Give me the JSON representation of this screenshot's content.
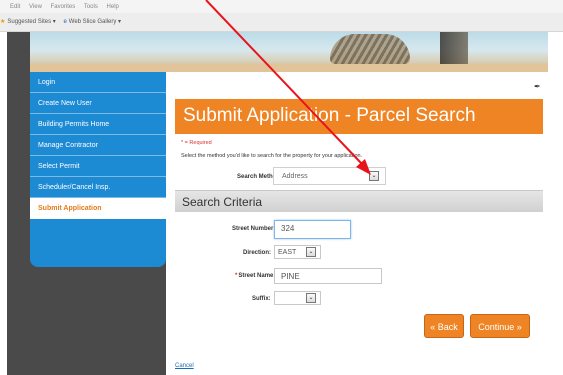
{
  "browser": {
    "menu": [
      "Edit",
      "View",
      "Favorites",
      "Tools",
      "Help"
    ],
    "favorites": [
      {
        "icon": "star-icon",
        "label": "Suggested Sites ▾"
      },
      {
        "icon": "ie-icon",
        "label": "Web Slice Gallery ▾"
      }
    ]
  },
  "sidebar": {
    "items": [
      {
        "label": "Login"
      },
      {
        "label": "Create New User"
      },
      {
        "label": "Building Permits Home"
      },
      {
        "label": "Manage Contractor"
      },
      {
        "label": "Select Permit"
      },
      {
        "label": "Scheduler/Cancel Insp."
      },
      {
        "label": "Submit Application",
        "active": true
      }
    ]
  },
  "main": {
    "edit_icon": "✒",
    "title": "Submit Application - Parcel Search",
    "required_note": "* = Required",
    "instruction": "Select the method you'd like to search for the property for your application.",
    "search_method": {
      "label": "Search Method:",
      "value": "Address"
    },
    "criteria": {
      "title": "Search Criteria",
      "street_number": {
        "label": "Street Number:",
        "value": "324"
      },
      "direction": {
        "label": "Direction:",
        "value": "EAST"
      },
      "street_name": {
        "required_mark": "*",
        "label": "Street Name:",
        "value": "PINE"
      },
      "suffix": {
        "label": "Suffix:",
        "value": ""
      }
    },
    "back_button": "« Back",
    "continue_button": "Continue »",
    "cancel_link": "Cancel"
  },
  "annotation": {
    "color": "#e8141b"
  },
  "colors": {
    "accent": "#ef8425",
    "sidebar": "#1d8ad4"
  }
}
